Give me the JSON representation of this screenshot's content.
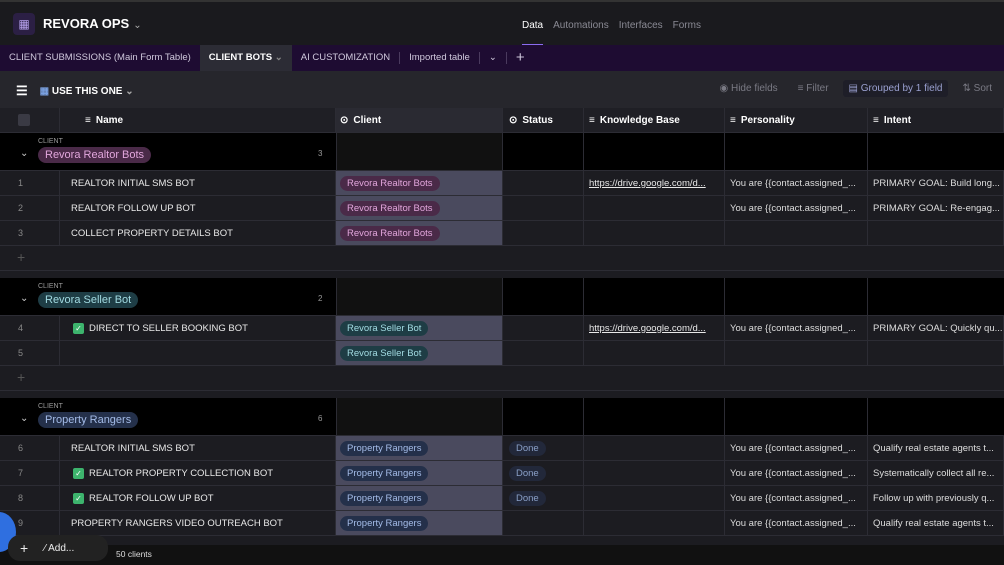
{
  "app": {
    "title": "REVORA OPS",
    "nav": [
      "Data",
      "Automations",
      "Interfaces",
      "Forms"
    ]
  },
  "tables": [
    "CLIENT SUBMISSIONS (Main Form Table)",
    "CLIENT BOTS",
    "AI CUSTOMIZATION",
    "Imported table"
  ],
  "view": {
    "name": "USE THIS ONE",
    "hide_fields": "Hide fields",
    "filter": "Filter",
    "grouped": "Grouped by 1 field",
    "sort": "Sort"
  },
  "columns": [
    "Name",
    "Client",
    "Status",
    "Knowledge Base",
    "Personality",
    "Intent"
  ],
  "group_label": "CLIENT",
  "groups": [
    {
      "name": "Revora Realtor Bots",
      "count": "3",
      "bg": "#4a2a48",
      "fg": "#e2a6dc",
      "rows": [
        {
          "n": "1",
          "name": "REALTOR INITIAL SMS BOT",
          "check": false,
          "status": "",
          "kb": "https://drive.google.com/d...",
          "personality": "You are {{contact.assigned_...",
          "intent": "PRIMARY GOAL: Build long..."
        },
        {
          "n": "2",
          "name": "REALTOR FOLLOW UP BOT",
          "check": false,
          "status": "",
          "kb": "",
          "personality": "You are {{contact.assigned_...",
          "intent": "PRIMARY GOAL: Re-engag..."
        },
        {
          "n": "3",
          "name": "COLLECT PROPERTY DETAILS BOT",
          "check": false,
          "status": "",
          "kb": "",
          "personality": "",
          "intent": ""
        }
      ]
    },
    {
      "name": "Revora Seller Bot",
      "count": "2",
      "bg": "#1e3d45",
      "fg": "#a2dbe2",
      "rows": [
        {
          "n": "4",
          "name": "DIRECT TO SELLER BOOKING BOT",
          "check": true,
          "status": "",
          "kb": "https://drive.google.com/d...",
          "personality": "You are {{contact.assigned_...",
          "intent": "PRIMARY GOAL: Quickly qu..."
        },
        {
          "n": "5",
          "name": "",
          "check": false,
          "status": "",
          "kb": "",
          "personality": "",
          "intent": ""
        }
      ]
    },
    {
      "name": "Property Rangers",
      "count": "6",
      "bg": "#24304a",
      "fg": "#a4bce8",
      "rows": [
        {
          "n": "6",
          "name": "REALTOR INITIAL SMS BOT",
          "check": false,
          "status": "Done",
          "kb": "",
          "personality": "You are {{contact.assigned_...",
          "intent": "Qualify real estate agents t..."
        },
        {
          "n": "7",
          "name": "REALTOR PROPERTY COLLECTION BOT",
          "check": true,
          "status": "Done",
          "kb": "",
          "personality": "You are {{contact.assigned_...",
          "intent": "Systematically collect all re..."
        },
        {
          "n": "8",
          "name": "REALTOR FOLLOW UP BOT",
          "check": true,
          "status": "Done",
          "kb": "",
          "personality": "You are {{contact.assigned_...",
          "intent": "Follow up with previously q..."
        },
        {
          "n": "9",
          "name": "PROPERTY RANGERS VIDEO OUTREACH BOT",
          "check": false,
          "status": "",
          "kb": "",
          "personality": "You are {{contact.assigned_...",
          "intent": "Qualify real estate agents t..."
        }
      ]
    }
  ],
  "footer": {
    "add": "Add...",
    "count": "50 clients"
  }
}
